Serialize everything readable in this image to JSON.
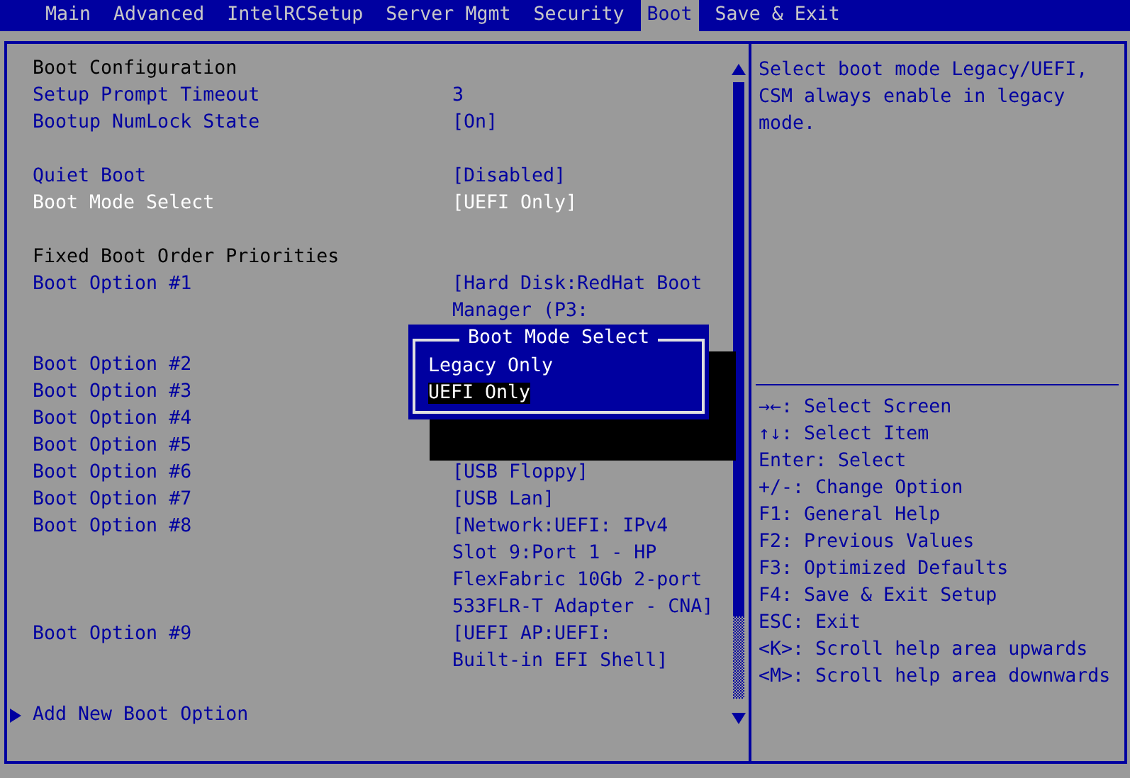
{
  "tabs": [
    {
      "label": "Main",
      "selected": false
    },
    {
      "label": "Advanced",
      "selected": false
    },
    {
      "label": "IntelRCSetup",
      "selected": false
    },
    {
      "label": "Server Mgmt",
      "selected": false
    },
    {
      "label": "Security",
      "selected": false
    },
    {
      "label": "Boot",
      "selected": true
    },
    {
      "label": "Save & Exit",
      "selected": false
    }
  ],
  "settings": [
    {
      "kind": "header",
      "label": "Boot Configuration"
    },
    {
      "kind": "setting",
      "label": "Setup Prompt Timeout",
      "value": "3",
      "selected": false
    },
    {
      "kind": "setting",
      "label": "Bootup NumLock State",
      "value": "[On]",
      "selected": false
    },
    {
      "kind": "spacer"
    },
    {
      "kind": "setting",
      "label": "Quiet Boot",
      "value": "[Disabled]",
      "selected": false
    },
    {
      "kind": "setting",
      "label": "Boot Mode Select",
      "value": "[UEFI Only]",
      "selected": true
    },
    {
      "kind": "spacer"
    },
    {
      "kind": "header",
      "label": "Fixed Boot Order Priorities"
    },
    {
      "kind": "setting",
      "label": "Boot Option #1",
      "value": "[Hard Disk:RedHat Boot\nManager (P3:",
      "selected": false
    },
    {
      "kind": "spacer"
    },
    {
      "kind": "setting",
      "label": "Boot Option #2",
      "selected": false
    },
    {
      "kind": "setting",
      "label": "Boot Option #3",
      "selected": false
    },
    {
      "kind": "setting",
      "label": "Boot Option #4",
      "selected": false
    },
    {
      "kind": "setting",
      "label": "Boot Option #5",
      "selected": false
    },
    {
      "kind": "setting",
      "label": "Boot Option #6",
      "value": "[USB Floppy]",
      "selected": false
    },
    {
      "kind": "setting",
      "label": "Boot Option #7",
      "value": "[USB Lan]",
      "selected": false
    },
    {
      "kind": "setting",
      "label": "Boot Option #8",
      "value": "[Network:UEFI: IPv4\nSlot 9:Port 1 - HP\nFlexFabric 10Gb 2-port\n533FLR-T Adapter - CNA]",
      "selected": false
    },
    {
      "kind": "setting",
      "label": "Boot Option #9",
      "value": "[UEFI AP:UEFI:\nBuilt-in EFI Shell]",
      "selected": false
    },
    {
      "kind": "spacer"
    },
    {
      "kind": "submenu",
      "label": "Add New Boot Option",
      "selected": false
    }
  ],
  "popup": {
    "title": "Boot Mode Select",
    "options": [
      {
        "label": "Legacy Only",
        "selected": false
      },
      {
        "label": "UEFI Only",
        "selected": true
      }
    ]
  },
  "help_text": "Select boot mode Legacy/UEFI, CSM always enable in legacy mode.",
  "key_help": [
    "→←: Select Screen",
    "↑↓: Select Item",
    "Enter: Select",
    "+/-: Change Option",
    "F1: General Help",
    "F2: Previous Values",
    "F3: Optimized Defaults",
    "F4: Save & Exit Setup",
    "ESC: Exit",
    "<K>: Scroll help area upwards",
    "<M>: Scroll help area downwards"
  ]
}
